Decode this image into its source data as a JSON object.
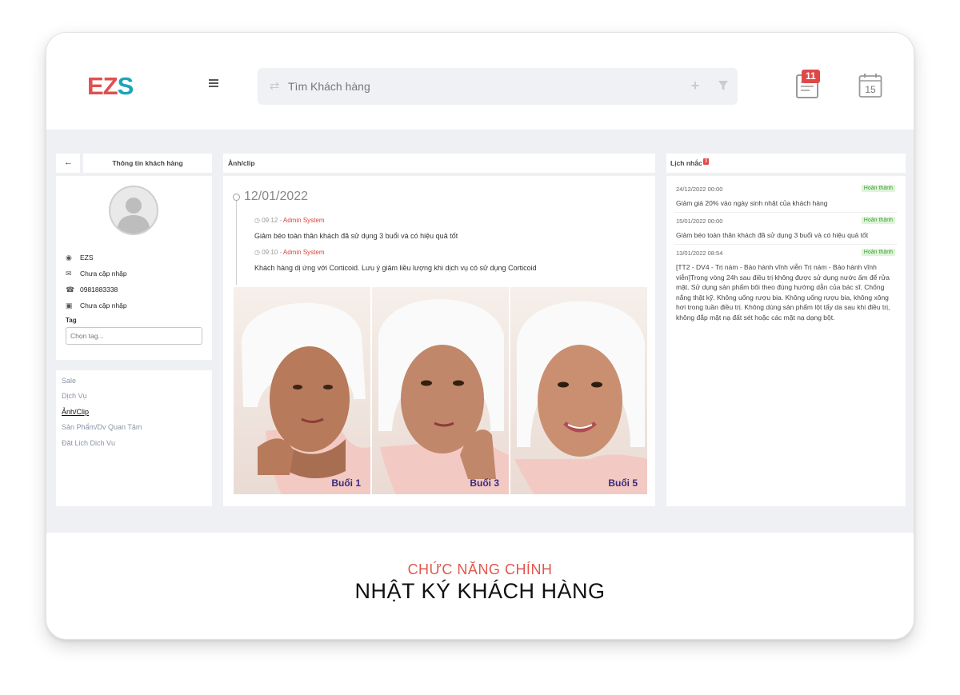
{
  "brand": {
    "logo_part1": "EZ",
    "logo_part2": "S"
  },
  "search": {
    "placeholder": "Tìm Khách hàng"
  },
  "notifications": {
    "badge_count": "11",
    "calendar_day": "15"
  },
  "customer_panel": {
    "title": "Thông tin khách hàng",
    "name": "EZS",
    "email": "Chưa cập nhập",
    "phone": "0981883338",
    "address": "Chưa cập nhập",
    "tag_label": "Tag",
    "tag_placeholder": "Chọn tag..."
  },
  "menu": {
    "items": [
      {
        "label": "Sale"
      },
      {
        "label": "Dịch Vụ"
      },
      {
        "label": "Ảnh/Clip"
      },
      {
        "label": "Sản Phẩm/Dv Quan Tâm"
      },
      {
        "label": "Đặt Lịch Dịch Vụ"
      }
    ],
    "active": "Ảnh/Clip"
  },
  "media_panel": {
    "title": "Ảnh/clip",
    "date": "12/01/2022",
    "entries": [
      {
        "time": "09:12",
        "author": "Admin System",
        "text": "Giảm béo toàn thân khách đã sử dụng 3 buổi và có hiệu quả tốt"
      },
      {
        "time": "09:10",
        "author": "Admin System",
        "text": "Khách hàng dị ứng với Corticoid. Lưu ý giảm liều lượng khi dịch vụ có sử dụng Corticoid"
      }
    ],
    "photos": [
      {
        "label": "Buổi 1"
      },
      {
        "label": "Buổi 3"
      },
      {
        "label": "Buổi 5"
      }
    ]
  },
  "reminders": {
    "title": "Lịch nhắc",
    "badge": "3",
    "items": [
      {
        "date": "24/12/2022 00:00",
        "status": "Hoàn thành",
        "text": "Giảm giá 20% vào ngày sinh nhật của khách hàng"
      },
      {
        "date": "15/01/2022 00:00",
        "status": "Hoàn thành",
        "text": "Giảm béo toàn thân khách đã sử dụng 3 buổi và có hiệu quả tốt"
      },
      {
        "date": "13/01/2022 08:54",
        "status": "Hoàn thành",
        "text": "[TT2 - DV4 - Trị nám - Bảo hành vĩnh viễn Trị nám - Bảo hành vĩnh viễn]Trong vòng 24h sau điều trị không được sử dụng nước ấm để rửa mặt. Sử dụng sản phẩm bôi theo đúng hướng dẫn của bác sĩ. Chống nắng thật kỹ. Không uống rượu bia. Không uống rượu bia, không xông hơi trong tuần điều trị. Không dùng sản phẩm lột tẩy da sau khi điều trị, không đắp mặt nạ đất sét hoặc các mặt nạ dạng bột."
      }
    ]
  },
  "caption": {
    "subtitle": "CHỨC NĂNG CHÍNH",
    "title": "NHẬT KÝ KHÁCH HÀNG"
  },
  "colors": {
    "accent_red": "#e24f4f",
    "brand_teal": "#1aa6b7",
    "status_green": "#3c9c3c",
    "content_bg": "#eef0f4"
  },
  "icons": {
    "back": "arrow-left-icon",
    "menu": "hamburger-icon",
    "refresh": "refresh-icon",
    "add": "plus-icon",
    "filter": "filter-icon",
    "notes": "notes-icon",
    "calendar": "calendar-icon"
  }
}
